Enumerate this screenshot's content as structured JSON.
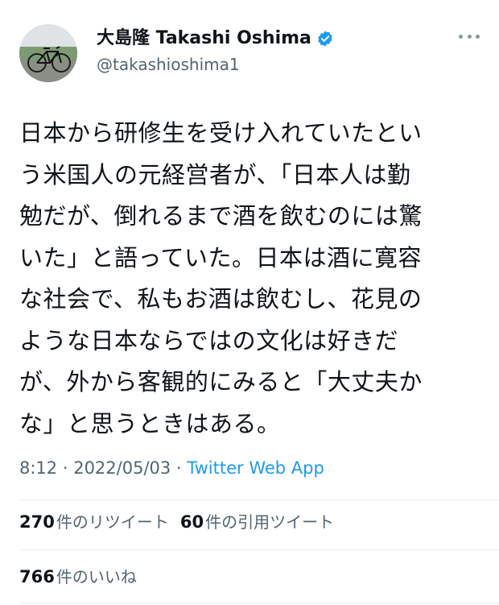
{
  "author": {
    "display_name": "大島隆 Takashi Oshima",
    "handle": "@takashioshima1",
    "verified": true,
    "avatar_icon": "bicycle-photo"
  },
  "tweet": {
    "lines": [
      "日本から研修生を受け入れていたとい",
      "う米国人の元経営者が、「日本人は勤",
      "勉だが、倒れるまで酒を飲むのには驚",
      "いた」と語っていた。日本は酒に寛容",
      "な社会で、私もお酒は飲むし、花見の",
      "ような日本ならではの文化は好きだ",
      "が、外から客観的にみると「大丈夫か",
      "な」と思うときはある。"
    ]
  },
  "meta": {
    "time": "8:12",
    "sep1": " · ",
    "date": "2022/05/03",
    "sep2": " · ",
    "app": "Twitter Web App"
  },
  "stats": {
    "retweets_count": "270",
    "retweets_label": "件のリツイート",
    "quotes_count": "60",
    "quotes_label": "件の引用ツイート",
    "likes_count": "766",
    "likes_label": "件のいいね"
  },
  "colors": {
    "accent": "#1d9bf0",
    "text": "#0f1419",
    "secondary": "#536471"
  }
}
